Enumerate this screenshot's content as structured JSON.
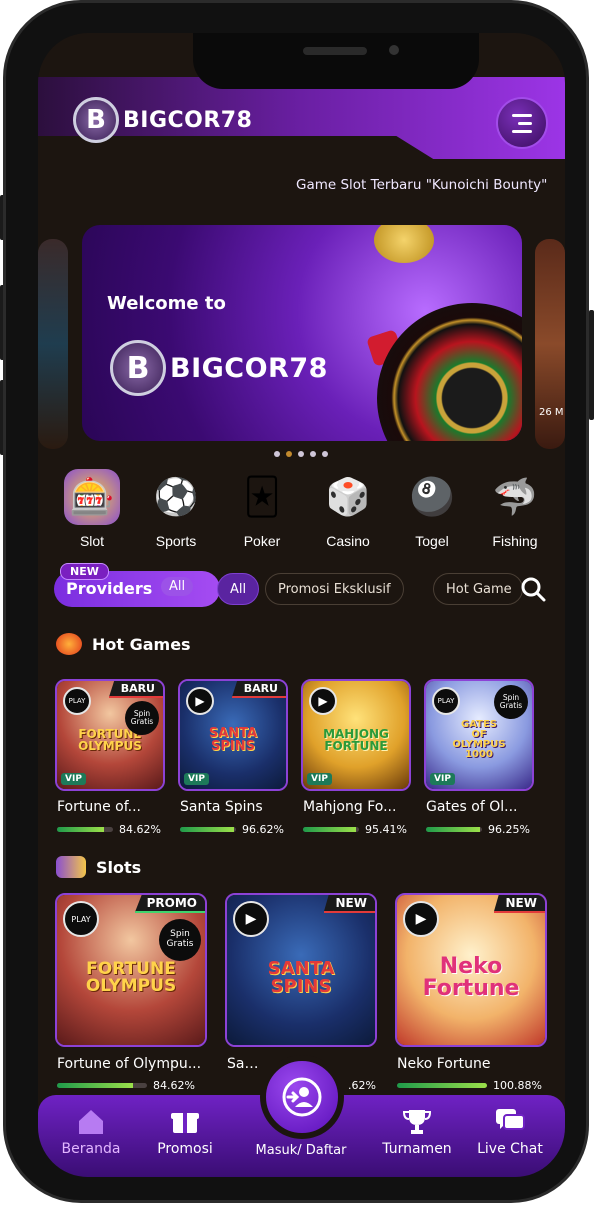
{
  "header": {
    "brand": "BIGCOR78",
    "coin_letter": "B"
  },
  "marquee": {
    "text": "Game Slot Terbaru \"Kunoichi Bounty\""
  },
  "banner": {
    "welcome": "Welcome to",
    "brand": "BIGCOR78",
    "side_date": "26 M",
    "dots_total": 5,
    "active_dot": 1
  },
  "categories": [
    {
      "label": "Slot",
      "icon": "slot-machine-icon"
    },
    {
      "label": "Sports",
      "icon": "soccer-ball-icon"
    },
    {
      "label": "Poker",
      "icon": "playing-cards-icon"
    },
    {
      "label": "Casino",
      "icon": "dice-icon"
    },
    {
      "label": "Togel",
      "icon": "lottery-balls-icon"
    },
    {
      "label": "Fishing",
      "icon": "shark-icon"
    }
  ],
  "filters": {
    "providers_badge": "NEW",
    "providers_label": "Providers",
    "providers_all": "All",
    "chips": [
      "All",
      "Promosi Eksklusif",
      "Hot Game"
    ]
  },
  "hot_games": {
    "title": "Hot Games",
    "items": [
      {
        "name": "Fortune of...",
        "rtp": "84.62%",
        "rtp_value": 84.62,
        "tag": "BARU",
        "art": "FORTUNE OLYMPUS",
        "spin": "Spin Gratis",
        "vip": "VIP",
        "play": "PLAY"
      },
      {
        "name": "Santa Spins",
        "rtp": "96.62%",
        "rtp_value": 96.62,
        "tag": "BARU",
        "art": "SANTA SPINS",
        "spin": "",
        "vip": "VIP",
        "play": ""
      },
      {
        "name": "Mahjong Fo...",
        "rtp": "95.41%",
        "rtp_value": 95.41,
        "tag": "",
        "art": "MAHJONG FORTUNE",
        "spin": "",
        "vip": "VIP",
        "play": ""
      },
      {
        "name": "Gates of Ol...",
        "rtp": "96.25%",
        "rtp_value": 96.25,
        "tag": "",
        "art": "GATES OF OLYMPUS 1000",
        "spin": "Spin Gratis",
        "vip": "VIP",
        "play": "PLAY"
      }
    ]
  },
  "slots": {
    "title": "Slots",
    "items": [
      {
        "name": "Fortune of Olympu...",
        "rtp": "84.62%",
        "rtp_value": 84.62,
        "tag": "PROMO",
        "art": "FORTUNE OLYMPUS",
        "spin": "Spin Gratis",
        "play": "PLAY"
      },
      {
        "name": "Santa",
        "rtp": ".62%",
        "rtp_value": 96.62,
        "tag": "NEW",
        "art": "SANTA SPINS",
        "spin": "",
        "play": ""
      },
      {
        "name": "Neko Fortune",
        "rtp": "100.88%",
        "rtp_value": 100,
        "tag": "NEW",
        "art": "Neko Fortune",
        "spin": "",
        "play": ""
      }
    ]
  },
  "bottom_nav": {
    "items": [
      {
        "label": "Beranda",
        "icon": "home-icon",
        "active": true
      },
      {
        "label": "Promosi",
        "icon": "gift-icon",
        "active": false
      },
      {
        "label": "Masuk/ Daftar",
        "icon": "login-icon",
        "active": false
      },
      {
        "label": "Turnamen",
        "icon": "trophy-icon",
        "active": false
      },
      {
        "label": "Live Chat",
        "icon": "chat-icon",
        "active": false
      }
    ]
  },
  "colors": {
    "accent": "#9c35e6",
    "background": "#1c1510",
    "rtp_bar": "#6cc443"
  }
}
